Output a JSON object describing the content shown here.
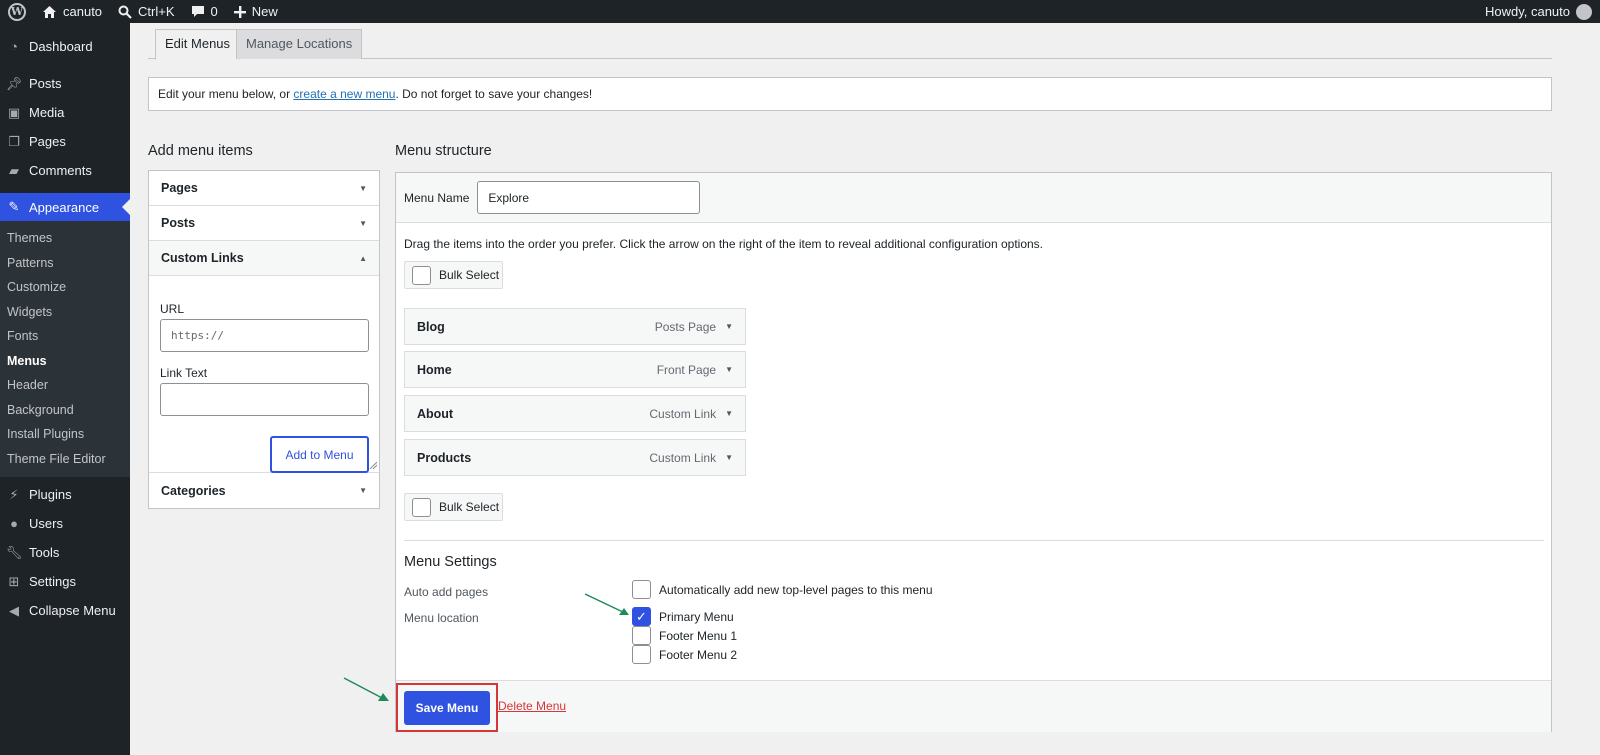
{
  "adminbar": {
    "site_name": "canuto",
    "search_shortcut": "Ctrl+K",
    "comments_count": "0",
    "new_label": "New",
    "greeting": "Howdy, canuto"
  },
  "sidebar": {
    "items_top": [
      {
        "label": "Dashboard",
        "icon": "dashboard-icon"
      },
      {
        "label": "Posts",
        "icon": "pin-icon"
      },
      {
        "label": "Media",
        "icon": "media-icon"
      },
      {
        "label": "Pages",
        "icon": "pages-icon"
      },
      {
        "label": "Comments",
        "icon": "comments-icon"
      }
    ],
    "current": {
      "label": "Appearance",
      "icon": "appearance-icon"
    },
    "submenu": [
      "Themes",
      "Patterns",
      "Customize",
      "Widgets",
      "Fonts",
      "Menus",
      "Header",
      "Background",
      "Install Plugins",
      "Theme File Editor"
    ],
    "submenu_current": "Menus",
    "items_bottom": [
      {
        "label": "Plugins",
        "icon": "plugins-icon"
      },
      {
        "label": "Users",
        "icon": "users-icon"
      },
      {
        "label": "Tools",
        "icon": "tools-icon"
      },
      {
        "label": "Settings",
        "icon": "settings-icon"
      },
      {
        "label": "Collapse Menu",
        "icon": "collapse-icon"
      }
    ]
  },
  "tabs": {
    "edit_menus": "Edit Menus",
    "manage_locations": "Manage Locations"
  },
  "notice": {
    "before": "Edit your menu below, or ",
    "link": "create a new menu",
    "after": ". Do not forget to save your changes!"
  },
  "add_items": {
    "title": "Add menu items",
    "pages": "Pages",
    "posts": "Posts",
    "custom_links": "Custom Links",
    "url_label": "URL",
    "url_placeholder": "https://",
    "link_text_label": "Link Text",
    "add_button": "Add to Menu",
    "categories": "Categories"
  },
  "structure": {
    "title": "Menu structure",
    "menu_name_label": "Menu Name",
    "menu_name_value": "Explore",
    "instructions": "Drag the items into the order you prefer. Click the arrow on the right of the item to reveal additional configuration options.",
    "bulk_select": "Bulk Select",
    "items": [
      {
        "title": "Blog",
        "type": "Posts Page"
      },
      {
        "title": "Home",
        "type": "Front Page"
      },
      {
        "title": "About",
        "type": "Custom Link"
      },
      {
        "title": "Products",
        "type": "Custom Link"
      }
    ]
  },
  "settings": {
    "title": "Menu Settings",
    "auto_add_label": "Auto add pages",
    "auto_add_option": "Automatically add new top-level pages to this menu",
    "location_label": "Menu location",
    "locations": [
      {
        "label": "Primary Menu",
        "checked": true
      },
      {
        "label": "Footer Menu 1",
        "checked": false
      },
      {
        "label": "Footer Menu 2",
        "checked": false
      }
    ]
  },
  "footer": {
    "save": "Save Menu",
    "delete": "Delete Menu"
  },
  "colors": {
    "accent": "#2f52e0",
    "highlight": "#d63638",
    "annotation_arrow": "#1e8a5a"
  }
}
